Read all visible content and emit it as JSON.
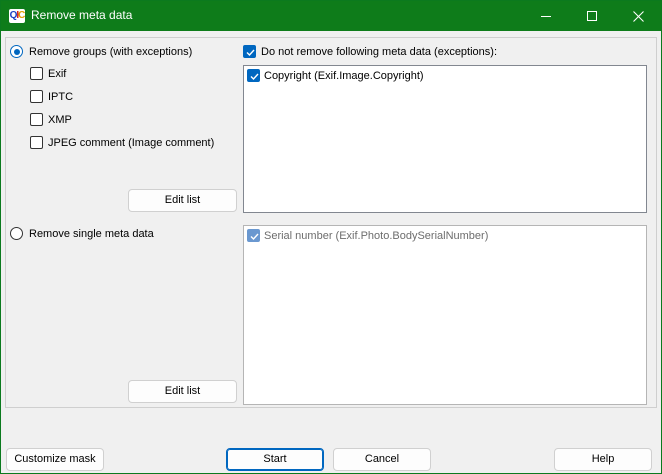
{
  "window": {
    "title": "Remove meta data",
    "icon_letters": [
      "Q",
      "I",
      "C"
    ]
  },
  "groups_section": {
    "radio_label": "Remove groups (with exceptions)",
    "radio_selected": true,
    "items": [
      {
        "label": "Exif",
        "checked": false
      },
      {
        "label": "IPTC",
        "checked": false
      },
      {
        "label": "XMP",
        "checked": false
      },
      {
        "label": "JPEG comment (Image comment)",
        "checked": false
      }
    ],
    "edit_list_label": "Edit list"
  },
  "exceptions": {
    "checkbox_label": "Do not remove following meta data (exceptions):",
    "checked": true,
    "list_items": [
      {
        "label": "Copyright (Exif.Image.Copyright)",
        "checked": true
      }
    ]
  },
  "single_section": {
    "radio_label": "Remove single meta data",
    "radio_selected": false,
    "list_items": [
      {
        "label": "Serial number (Exif.Photo.BodySerialNumber)",
        "checked": true,
        "disabled": true
      }
    ],
    "edit_list_label": "Edit list"
  },
  "footer": {
    "customize_mask_label": "Customize mask",
    "start_label": "Start",
    "cancel_label": "Cancel",
    "help_label": "Help"
  },
  "colors": {
    "titlebar": "#0e7c1a",
    "accent": "#0067c0"
  }
}
